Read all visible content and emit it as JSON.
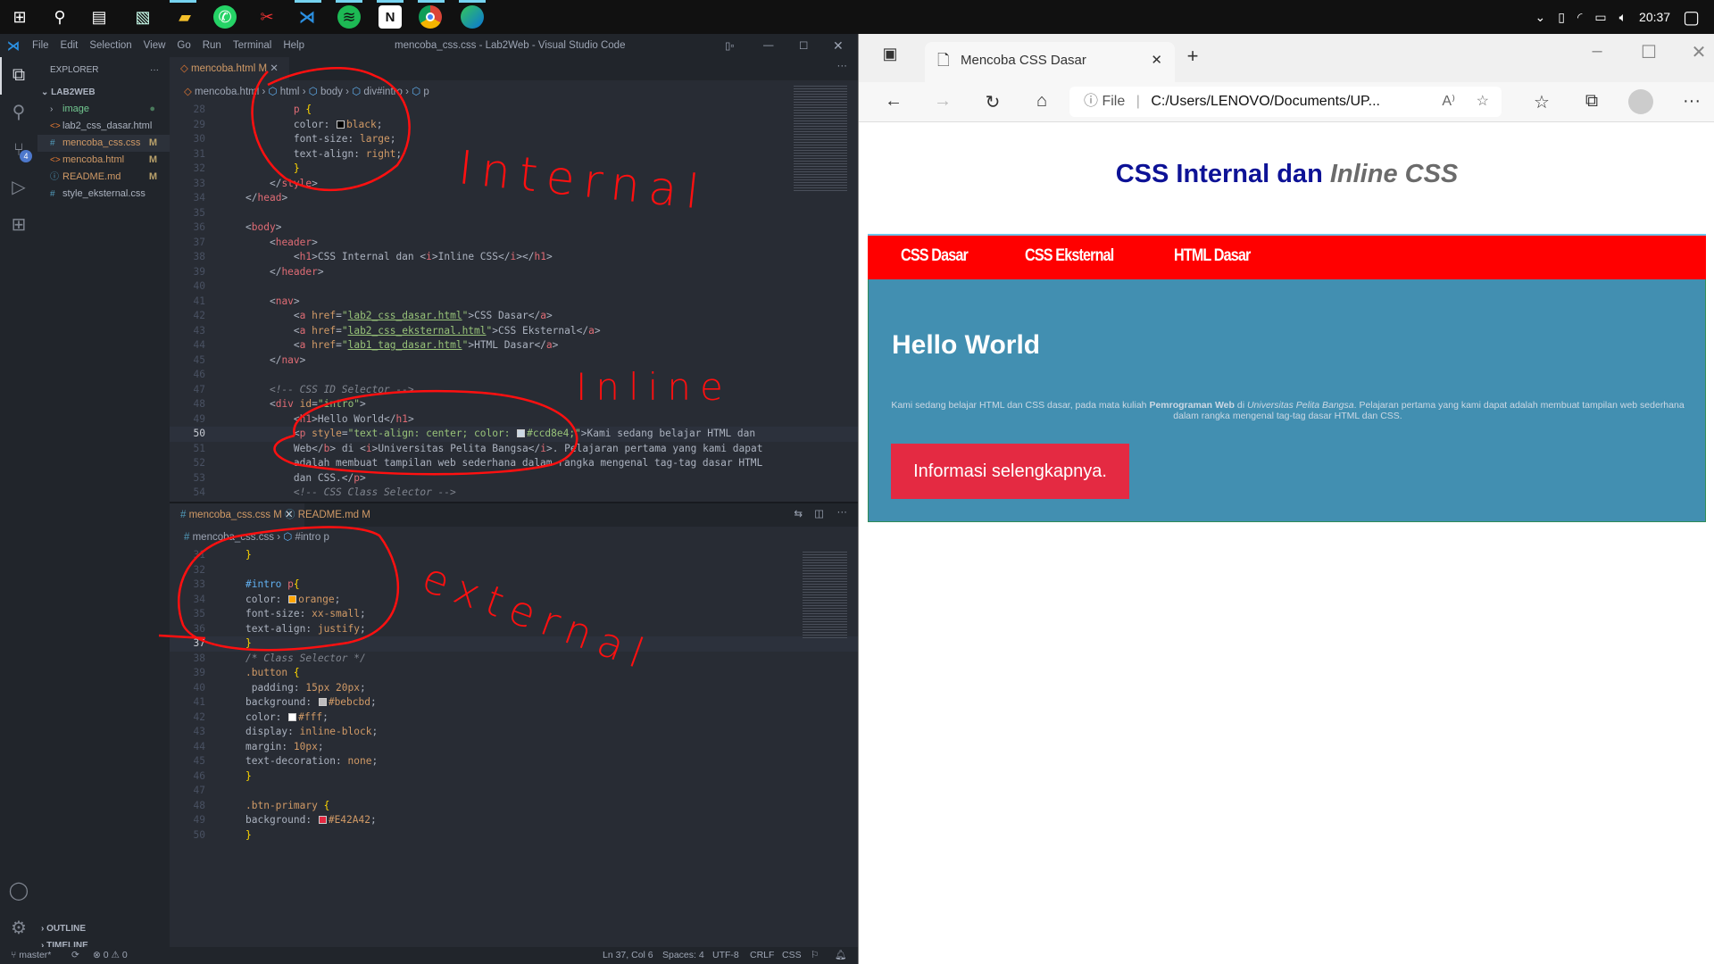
{
  "taskbar": {
    "icons": [
      "windows-start-icon",
      "search-icon",
      "task-view-icon",
      "presentation-app-icon",
      "file-explorer-icon",
      "whatsapp-icon",
      "snipping-tool-icon",
      "vscode-icon",
      "spotify-icon",
      "notion-icon",
      "chrome-icon",
      "edge-icon"
    ],
    "tray_time": "20:37"
  },
  "vscode": {
    "menu": [
      "File",
      "Edit",
      "Selection",
      "View",
      "Go",
      "Run",
      "Terminal",
      "Help"
    ],
    "title": "mencoba_css.css - Lab2Web - Visual Studio Code",
    "explorer": {
      "header": "EXPLORER",
      "folder": "LAB2WEB",
      "items": [
        {
          "name": "image",
          "type": "folder",
          "badge": ""
        },
        {
          "name": "lab2_css_dasar.html",
          "type": "html",
          "badge": ""
        },
        {
          "name": "mencoba_css.css",
          "type": "css",
          "badge": "M"
        },
        {
          "name": "mencoba.html",
          "type": "html",
          "badge": "M"
        },
        {
          "name": "README.md",
          "type": "info",
          "badge": "M"
        },
        {
          "name": "style_eksternal.css",
          "type": "css",
          "badge": ""
        }
      ],
      "source_control_badge": "4",
      "outline": "OUTLINE",
      "timeline": "TIMELINE"
    },
    "top_editor": {
      "tab": "mencoba.html",
      "tab_badge": "M",
      "breadcrumb": [
        "mencoba.html",
        "html",
        "body",
        "div#intro",
        "p"
      ],
      "lines": [
        {
          "n": "28",
          "i": 8,
          "t": [
            [
              "t-sel",
              "p"
            ],
            [
              "t-brace",
              " {"
            ]
          ]
        },
        {
          "n": "29",
          "i": 8,
          "t": [
            [
              "t-prop",
              "color: "
            ],
            [
              "sw",
              "#000000"
            ],
            [
              "t-val",
              "black"
            ],
            [
              "t-txt",
              ";"
            ]
          ]
        },
        {
          "n": "30",
          "i": 8,
          "t": [
            [
              "t-prop",
              "font-size: "
            ],
            [
              "t-val",
              "large"
            ],
            [
              "t-txt",
              ";"
            ]
          ]
        },
        {
          "n": "31",
          "i": 8,
          "t": [
            [
              "t-prop",
              "text-align: "
            ],
            [
              "t-val",
              "right"
            ],
            [
              "t-txt",
              ";"
            ]
          ]
        },
        {
          "n": "32",
          "i": 8,
          "t": [
            [
              "t-brace",
              "}"
            ]
          ]
        },
        {
          "n": "33",
          "i": 4,
          "t": [
            [
              "t-br",
              "</"
            ],
            [
              "t-tag",
              "style"
            ],
            [
              "t-br",
              ">"
            ]
          ]
        },
        {
          "n": "34",
          "i": 0,
          "t": [
            [
              "t-br",
              "</"
            ],
            [
              "t-tag",
              "head"
            ],
            [
              "t-br",
              ">"
            ]
          ]
        },
        {
          "n": "35",
          "i": 0,
          "t": []
        },
        {
          "n": "36",
          "i": 0,
          "t": [
            [
              "t-br",
              "<"
            ],
            [
              "t-tag",
              "body"
            ],
            [
              "t-br",
              ">"
            ]
          ]
        },
        {
          "n": "37",
          "i": 4,
          "t": [
            [
              "t-br",
              "<"
            ],
            [
              "t-tag",
              "header"
            ],
            [
              "t-br",
              ">"
            ]
          ]
        },
        {
          "n": "38",
          "i": 8,
          "t": [
            [
              "t-br",
              "<"
            ],
            [
              "t-tag",
              "h1"
            ],
            [
              "t-br",
              ">"
            ],
            [
              "t-txt",
              "CSS Internal dan "
            ],
            [
              "t-br",
              "<"
            ],
            [
              "t-tag",
              "i"
            ],
            [
              "t-br",
              ">"
            ],
            [
              "t-txt",
              "Inline CSS"
            ],
            [
              "t-br",
              "</"
            ],
            [
              "t-tag",
              "i"
            ],
            [
              "t-br",
              "></"
            ],
            [
              "t-tag",
              "h1"
            ],
            [
              "t-br",
              ">"
            ]
          ]
        },
        {
          "n": "39",
          "i": 4,
          "t": [
            [
              "t-br",
              "</"
            ],
            [
              "t-tag",
              "header"
            ],
            [
              "t-br",
              ">"
            ]
          ]
        },
        {
          "n": "40",
          "i": 0,
          "t": []
        },
        {
          "n": "41",
          "i": 4,
          "t": [
            [
              "t-br",
              "<"
            ],
            [
              "t-tag",
              "nav"
            ],
            [
              "t-br",
              ">"
            ]
          ]
        },
        {
          "n": "42",
          "i": 8,
          "t": [
            [
              "t-br",
              "<"
            ],
            [
              "t-tag",
              "a"
            ],
            [
              "t-attr",
              " href"
            ],
            [
              "t-txt",
              "="
            ],
            [
              "t-strp",
              "\""
            ],
            [
              "t-str",
              "lab2_css_dasar.html"
            ],
            [
              "t-strp",
              "\""
            ],
            [
              "t-br",
              ">"
            ],
            [
              "t-txt",
              "CSS Dasar"
            ],
            [
              "t-br",
              "</"
            ],
            [
              "t-tag",
              "a"
            ],
            [
              "t-br",
              ">"
            ]
          ]
        },
        {
          "n": "43",
          "i": 8,
          "t": [
            [
              "t-br",
              "<"
            ],
            [
              "t-tag",
              "a"
            ],
            [
              "t-attr",
              " href"
            ],
            [
              "t-txt",
              "="
            ],
            [
              "t-strp",
              "\""
            ],
            [
              "t-str",
              "lab2_css_eksternal.html"
            ],
            [
              "t-strp",
              "\""
            ],
            [
              "t-br",
              ">"
            ],
            [
              "t-txt",
              "CSS Eksternal"
            ],
            [
              "t-br",
              "</"
            ],
            [
              "t-tag",
              "a"
            ],
            [
              "t-br",
              ">"
            ]
          ]
        },
        {
          "n": "44",
          "i": 8,
          "t": [
            [
              "t-br",
              "<"
            ],
            [
              "t-tag",
              "a"
            ],
            [
              "t-attr",
              " href"
            ],
            [
              "t-txt",
              "="
            ],
            [
              "t-strp",
              "\""
            ],
            [
              "t-str",
              "lab1_tag_dasar.html"
            ],
            [
              "t-strp",
              "\""
            ],
            [
              "t-br",
              ">"
            ],
            [
              "t-txt",
              "HTML Dasar"
            ],
            [
              "t-br",
              "</"
            ],
            [
              "t-tag",
              "a"
            ],
            [
              "t-br",
              ">"
            ]
          ]
        },
        {
          "n": "45",
          "i": 4,
          "t": [
            [
              "t-br",
              "</"
            ],
            [
              "t-tag",
              "nav"
            ],
            [
              "t-br",
              ">"
            ]
          ]
        },
        {
          "n": "46",
          "i": 0,
          "t": []
        },
        {
          "n": "47",
          "i": 4,
          "t": [
            [
              "t-com",
              "<!-- CSS ID Selector -->"
            ]
          ]
        },
        {
          "n": "48",
          "i": 4,
          "t": [
            [
              "t-br",
              "<"
            ],
            [
              "t-tag",
              "div"
            ],
            [
              "t-attr",
              " id"
            ],
            [
              "t-txt",
              "="
            ],
            [
              "t-strp",
              "\"intro\""
            ],
            [
              "t-br",
              ">"
            ]
          ]
        },
        {
          "n": "49",
          "i": 8,
          "t": [
            [
              "t-br",
              "<"
            ],
            [
              "t-tag",
              "h1"
            ],
            [
              "t-br",
              ">"
            ],
            [
              "t-txt",
              "Hello World"
            ],
            [
              "t-br",
              "</"
            ],
            [
              "t-tag",
              "h1"
            ],
            [
              "t-br",
              ">"
            ]
          ]
        },
        {
          "n": "50",
          "i": 8,
          "cur": true,
          "t": [
            [
              "t-br",
              "<"
            ],
            [
              "t-tag",
              "p"
            ],
            [
              "t-attr",
              " style"
            ],
            [
              "t-txt",
              "="
            ],
            [
              "t-strp",
              "\"text-align: center; color: "
            ],
            [
              "sw",
              "#ccd8e4"
            ],
            [
              "t-strp",
              "#ccd8e4;\""
            ],
            [
              "t-br",
              ">"
            ],
            [
              "t-txt",
              "Kami sedang belajar HTML dan"
            ]
          ]
        },
        {
          "n": "51",
          "i": 8,
          "t": [
            [
              "t-txt",
              "Web"
            ],
            [
              "t-br",
              "</"
            ],
            [
              "t-tag",
              "b"
            ],
            [
              "t-br",
              ">"
            ],
            [
              "t-txt",
              " di "
            ],
            [
              "t-br",
              "<"
            ],
            [
              "t-tag",
              "i"
            ],
            [
              "t-br",
              ">"
            ],
            [
              "t-txt",
              "Universitas Pelita Bangsa"
            ],
            [
              "t-br",
              "</"
            ],
            [
              "t-tag",
              "i"
            ],
            [
              "t-br",
              ">"
            ],
            [
              "t-txt",
              ". Pelajaran pertama yang kami dapat"
            ]
          ]
        },
        {
          "n": "52",
          "i": 8,
          "t": [
            [
              "t-txt",
              "adalah membuat tampilan web sederhana dalam rangka mengenal tag-tag dasar HTML"
            ]
          ]
        },
        {
          "n": "53",
          "i": 8,
          "t": [
            [
              "t-txt",
              "dan CSS."
            ],
            [
              "t-br",
              "</"
            ],
            [
              "t-tag",
              "p"
            ],
            [
              "t-br",
              ">"
            ]
          ]
        },
        {
          "n": "54",
          "i": 8,
          "t": [
            [
              "t-com",
              "<!-- CSS Class Selector -->"
            ]
          ]
        }
      ]
    },
    "bottom_editor": {
      "tabs": [
        {
          "label": "mencoba_css.css",
          "badge": "M"
        },
        {
          "label": "README.md",
          "badge": "M"
        }
      ],
      "breadcrumb": [
        "mencoba_css.css",
        "#intro p"
      ],
      "lines": [
        {
          "n": "31",
          "i": 0,
          "t": [
            [
              "t-brace",
              "}"
            ]
          ]
        },
        {
          "n": "32",
          "i": 0,
          "t": []
        },
        {
          "n": "33",
          "i": 0,
          "t": [
            [
              "t-id",
              "#intro"
            ],
            [
              "t-sel",
              " p"
            ],
            [
              "t-brace",
              "{"
            ]
          ]
        },
        {
          "n": "34",
          "i": 0,
          "t": [
            [
              "t-prop",
              "color: "
            ],
            [
              "sw",
              "#ffa500"
            ],
            [
              "t-val",
              "orange"
            ],
            [
              "t-txt",
              ";"
            ]
          ]
        },
        {
          "n": "35",
          "i": 0,
          "t": [
            [
              "t-prop",
              "font-size: "
            ],
            [
              "t-val",
              "xx-small"
            ],
            [
              "t-txt",
              ";"
            ]
          ]
        },
        {
          "n": "36",
          "i": 0,
          "t": [
            [
              "t-prop",
              "text-align: "
            ],
            [
              "t-val",
              "justify"
            ],
            [
              "t-txt",
              ";"
            ]
          ]
        },
        {
          "n": "37",
          "i": 0,
          "cur": true,
          "t": [
            [
              "t-brace",
              "}"
            ]
          ]
        },
        {
          "n": "38",
          "i": 0,
          "t": [
            [
              "t-com",
              "/* Class Selector */"
            ]
          ]
        },
        {
          "n": "39",
          "i": 0,
          "t": [
            [
              "t-cls",
              ".button"
            ],
            [
              "t-brace",
              " {"
            ]
          ]
        },
        {
          "n": "40",
          "i": 0,
          "t": [
            [
              "t-prop",
              " padding: "
            ],
            [
              "t-val",
              "15px 20px"
            ],
            [
              "t-txt",
              ";"
            ]
          ]
        },
        {
          "n": "41",
          "i": 0,
          "t": [
            [
              "t-prop",
              "background: "
            ],
            [
              "sw",
              "#bebcbd"
            ],
            [
              "t-val",
              "#bebcbd"
            ],
            [
              "t-txt",
              ";"
            ]
          ]
        },
        {
          "n": "42",
          "i": 0,
          "t": [
            [
              "t-prop",
              "color: "
            ],
            [
              "sw",
              "#ffffff"
            ],
            [
              "t-val",
              "#fff"
            ],
            [
              "t-txt",
              ";"
            ]
          ]
        },
        {
          "n": "43",
          "i": 0,
          "t": [
            [
              "t-prop",
              "display: "
            ],
            [
              "t-val",
              "inline-block"
            ],
            [
              "t-txt",
              ";"
            ]
          ]
        },
        {
          "n": "44",
          "i": 0,
          "t": [
            [
              "t-prop",
              "margin: "
            ],
            [
              "t-val",
              "10px"
            ],
            [
              "t-txt",
              ";"
            ]
          ]
        },
        {
          "n": "45",
          "i": 0,
          "t": [
            [
              "t-prop",
              "text-decoration: "
            ],
            [
              "t-val",
              "none"
            ],
            [
              "t-txt",
              ";"
            ]
          ]
        },
        {
          "n": "46",
          "i": 0,
          "t": [
            [
              "t-brace",
              "}"
            ]
          ]
        },
        {
          "n": "47",
          "i": 0,
          "t": []
        },
        {
          "n": "48",
          "i": 0,
          "t": [
            [
              "t-cls",
              ".btn-primary"
            ],
            [
              "t-brace",
              " {"
            ]
          ]
        },
        {
          "n": "49",
          "i": 0,
          "t": [
            [
              "t-prop",
              "background: "
            ],
            [
              "sw",
              "#E42A42"
            ],
            [
              "t-val",
              "#E42A42"
            ],
            [
              "t-txt",
              ";"
            ]
          ]
        },
        {
          "n": "50",
          "i": 0,
          "t": [
            [
              "t-brace",
              "}"
            ]
          ]
        }
      ]
    },
    "status": {
      "branch": "master*",
      "errors": "0",
      "warnings": "0",
      "position": "Ln 37, Col 6",
      "spaces": "Spaces: 4",
      "encoding": "UTF-8",
      "eol": "CRLF",
      "language": "CSS"
    }
  },
  "annotations": {
    "internal": "Internal",
    "inline": "Inline",
    "external": "external",
    "color": "#ff1010"
  },
  "browser": {
    "tab_title": "Mencoba CSS Dasar",
    "address_scheme": "File",
    "address": "C:/Users/LENOVO/Documents/UP...",
    "page": {
      "h1_plain": "CSS Internal dan ",
      "h1_italic": "Inline CSS",
      "nav": [
        "CSS Dasar",
        "CSS Eksternal",
        "HTML Dasar"
      ],
      "hello": "Hello World",
      "para": {
        "a": "Kami sedang belajar HTML dan CSS dasar, pada mata kuliah ",
        "b": "Pemrograman Web",
        "c": " di ",
        "i": "Universitas Pelita Bangsa",
        "d": ". Pelajaran pertama yang kami dapat adalah membuat tampilan web sederhana dalam rangka mengenal tag-tag dasar HTML dan CSS."
      },
      "button": "Informasi selengkapnya.",
      "colors": {
        "nav": "#ff0000",
        "intro": "#428fb1",
        "button": "#e42a42",
        "heading": "#0d1296",
        "para": "#ccd8e4"
      }
    }
  }
}
